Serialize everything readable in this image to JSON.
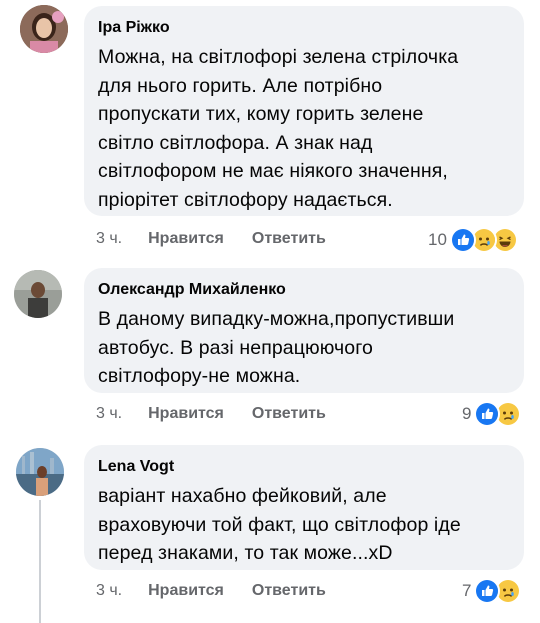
{
  "comments": [
    {
      "author": "Іра Ріжко",
      "text": "Можна, на світлофорі зелена стрілочка\nдля нього горить. Але потрібно\nпропускати тих, кому горить зелене\nсвітло світлофора. А знак над\nсвітлофором не має ніякого значення,\nпріорітет світлофору надається.",
      "time": "3 ч.",
      "like_label": "Нравится",
      "reply_label": "Ответить",
      "reaction_count": "10",
      "reactions": [
        "like-icon",
        "sad-icon",
        "haha-icon"
      ]
    },
    {
      "author": "Олександр Михайленко",
      "text": "В даному випадку-можна,пропустивши\nавтобус. В разі непрацюючого\nсвітлофору-не можна.",
      "time": "3 ч.",
      "like_label": "Нравится",
      "reply_label": "Ответить",
      "reaction_count": "9",
      "reactions": [
        "like-icon",
        "sad-icon"
      ]
    },
    {
      "author": "Lena Vogt",
      "text": "варіант нахабно фейковий, але\nвраховуючи той факт, що світлофор іде\nперед знаками, то так може...xD",
      "time": "3 ч.",
      "like_label": "Нравится",
      "reply_label": "Ответить",
      "reaction_count": "7",
      "reactions": [
        "like-icon",
        "sad-icon"
      ]
    }
  ],
  "colors": {
    "bubble": "#f0f2f5",
    "meta": "#65676b",
    "like_blue": "#1877f2",
    "emoji_yellow": "#f7c843"
  }
}
